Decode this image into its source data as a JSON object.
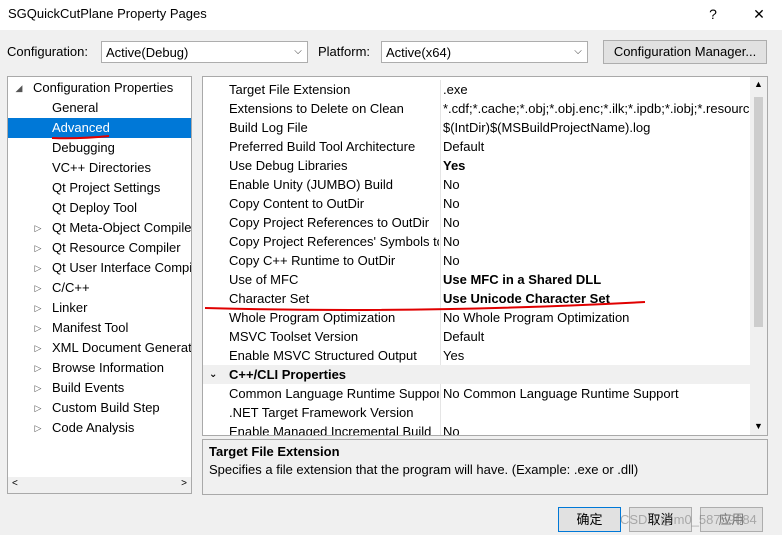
{
  "window": {
    "title": "SGQuickCutPlane Property Pages",
    "help_glyph": "?",
    "close_glyph": "✕"
  },
  "config_bar": {
    "configuration_label": "Configuration:",
    "configuration_value": "Active(Debug)",
    "platform_label": "Platform:",
    "platform_value": "Active(x64)",
    "config_manager_label": "Configuration Manager..."
  },
  "tree": {
    "root": "Configuration Properties",
    "items": [
      {
        "label": "General",
        "expandable": false,
        "selected": false
      },
      {
        "label": "Advanced",
        "expandable": false,
        "selected": true
      },
      {
        "label": "Debugging",
        "expandable": false,
        "selected": false
      },
      {
        "label": "VC++ Directories",
        "expandable": false,
        "selected": false
      },
      {
        "label": "Qt Project Settings",
        "expandable": false,
        "selected": false
      },
      {
        "label": "Qt Deploy Tool",
        "expandable": false,
        "selected": false
      },
      {
        "label": "Qt Meta-Object Compiler",
        "expandable": true,
        "selected": false
      },
      {
        "label": "Qt Resource Compiler",
        "expandable": true,
        "selected": false
      },
      {
        "label": "Qt User Interface Compiler",
        "expandable": true,
        "selected": false
      },
      {
        "label": "C/C++",
        "expandable": true,
        "selected": false
      },
      {
        "label": "Linker",
        "expandable": true,
        "selected": false
      },
      {
        "label": "Manifest Tool",
        "expandable": true,
        "selected": false
      },
      {
        "label": "XML Document Generator",
        "expandable": true,
        "selected": false
      },
      {
        "label": "Browse Information",
        "expandable": true,
        "selected": false
      },
      {
        "label": "Build Events",
        "expandable": true,
        "selected": false
      },
      {
        "label": "Custom Build Step",
        "expandable": true,
        "selected": false
      },
      {
        "label": "Code Analysis",
        "expandable": true,
        "selected": false
      }
    ]
  },
  "grid": {
    "rows": [
      {
        "name": "Target File Extension",
        "value": ".exe",
        "bold": false
      },
      {
        "name": "Extensions to Delete on Clean",
        "value": "*.cdf;*.cache;*.obj;*.obj.enc;*.ilk;*.ipdb;*.iobj;*.resources",
        "bold": false
      },
      {
        "name": "Build Log File",
        "value": "$(IntDir)$(MSBuildProjectName).log",
        "bold": false
      },
      {
        "name": "Preferred Build Tool Architecture",
        "value": "Default",
        "bold": false
      },
      {
        "name": "Use Debug Libraries",
        "value": "Yes",
        "bold": true
      },
      {
        "name": "Enable Unity (JUMBO) Build",
        "value": "No",
        "bold": false
      },
      {
        "name": "Copy Content to OutDir",
        "value": "No",
        "bold": false
      },
      {
        "name": "Copy Project References to OutDir",
        "value": "No",
        "bold": false
      },
      {
        "name": "Copy Project References' Symbols to OutDir",
        "value": "No",
        "bold": false
      },
      {
        "name": "Copy C++ Runtime to OutDir",
        "value": "No",
        "bold": false
      },
      {
        "name": "Use of MFC",
        "value": "Use MFC in a Shared DLL",
        "bold": true
      },
      {
        "name": "Character Set",
        "value": "Use Unicode Character Set",
        "bold": true
      },
      {
        "name": "Whole Program Optimization",
        "value": "No Whole Program Optimization",
        "bold": false
      },
      {
        "name": "MSVC Toolset Version",
        "value": "Default",
        "bold": false
      },
      {
        "name": "Enable MSVC Structured Output",
        "value": "Yes",
        "bold": false
      }
    ],
    "category": "C++/CLI Properties",
    "rows2": [
      {
        "name": "Common Language Runtime Support",
        "value": "No Common Language Runtime Support",
        "bold": false
      },
      {
        "name": ".NET Target Framework Version",
        "value": "",
        "bold": false
      },
      {
        "name": "Enable Managed Incremental Build",
        "value": "No",
        "bold": false
      }
    ]
  },
  "description": {
    "title": "Target File Extension",
    "text": "Specifies a file extension that the program will have. (Example: .exe or .dll)"
  },
  "buttons": {
    "ok": "确定",
    "cancel": "取消",
    "apply": "应用"
  },
  "watermark": "CSDN @m0_58759084",
  "colors": {
    "selection": "#0078d7",
    "annotation_red": "#e00000"
  }
}
